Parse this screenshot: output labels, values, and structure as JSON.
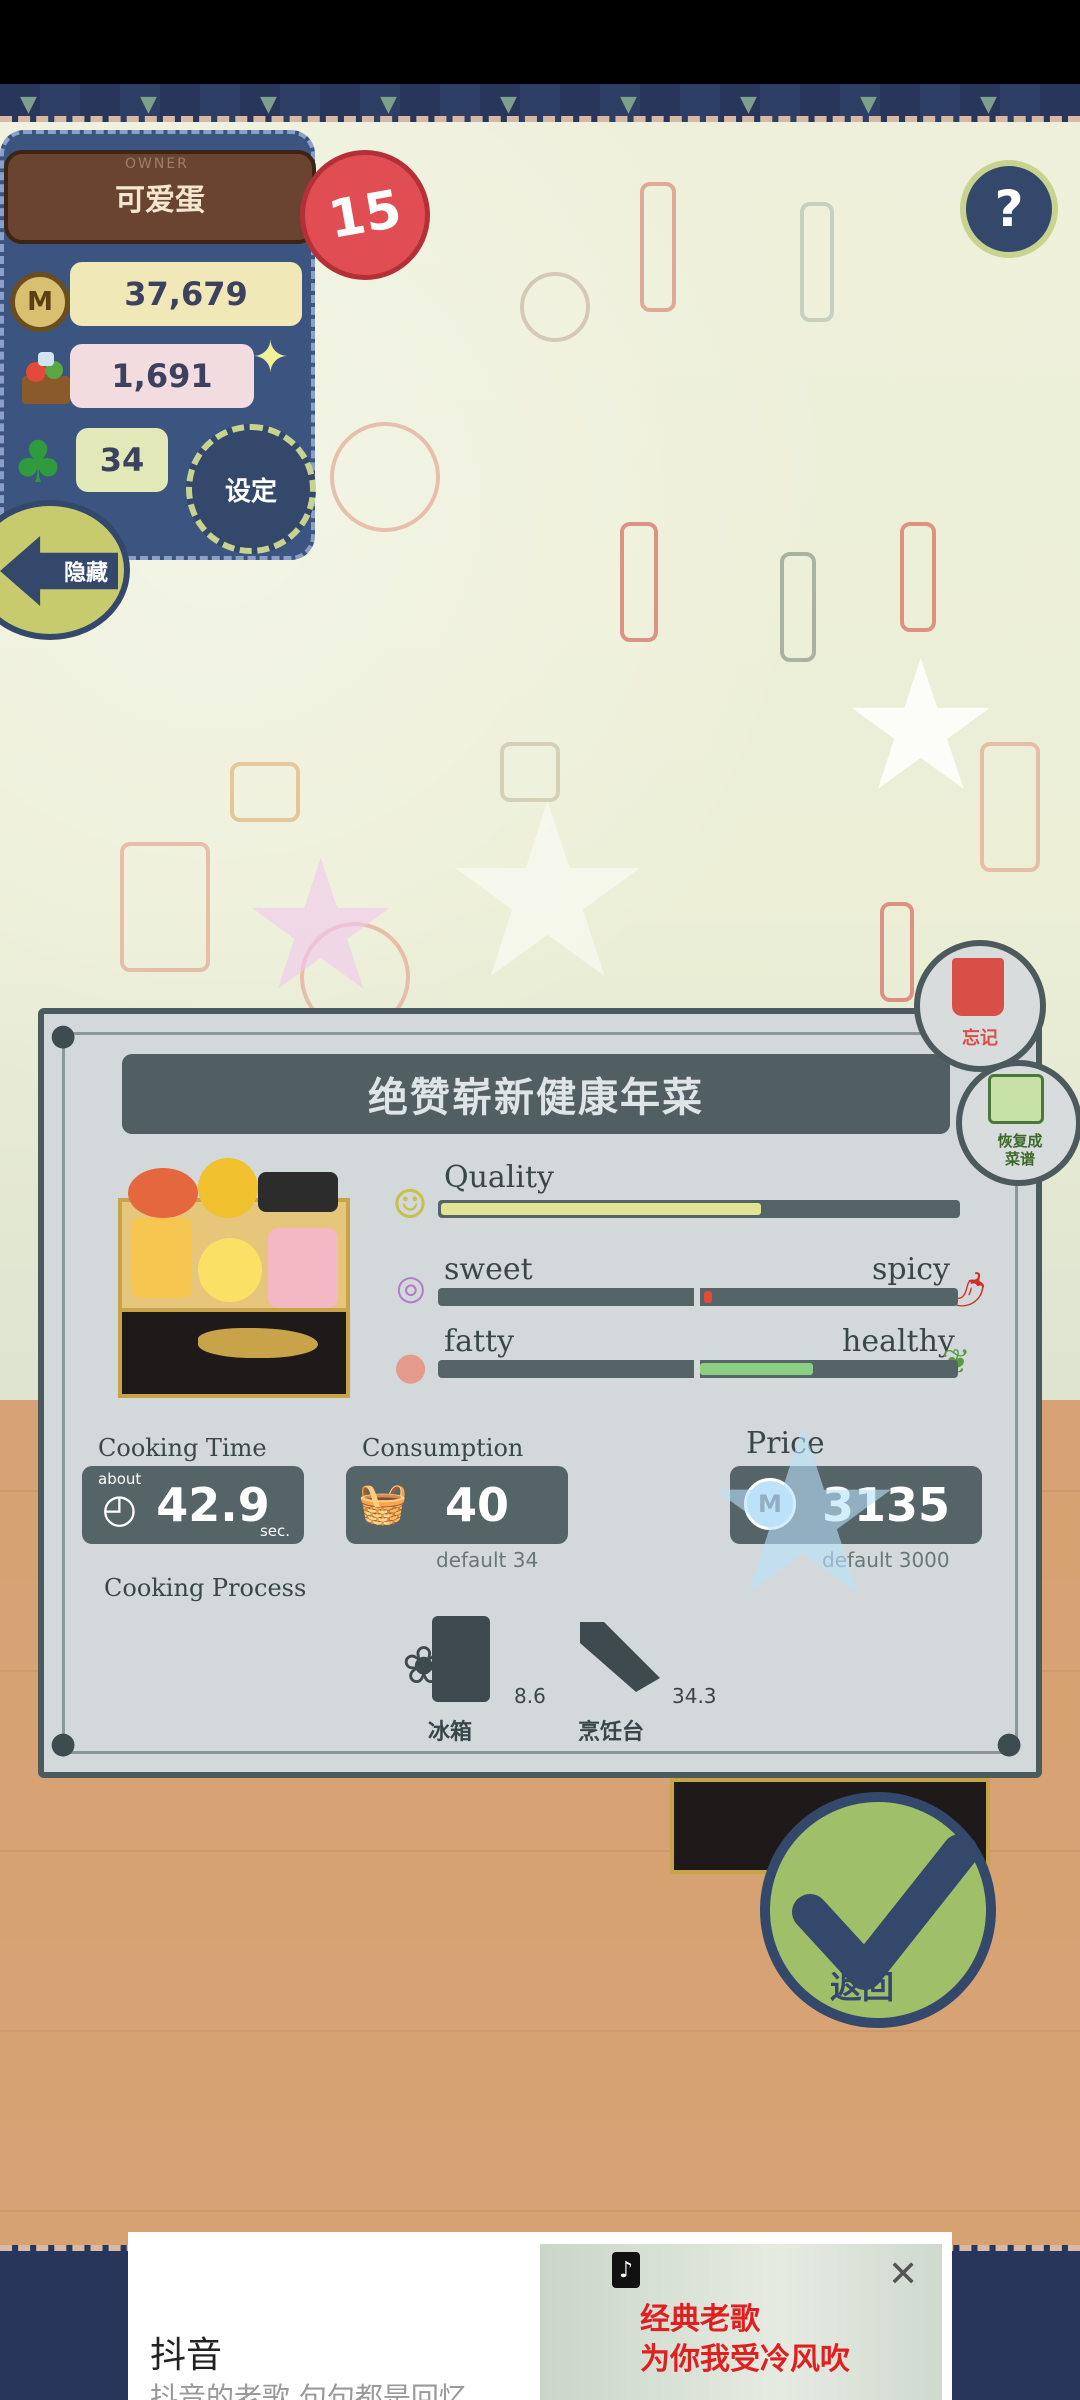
{
  "hud": {
    "owner_tag": "OWNER",
    "owner_name": "可爱蛋",
    "level": "15",
    "coins": "37,679",
    "ingredients": "1,691",
    "clovers": "34",
    "settings_label": "设定",
    "hide_label": "隐藏",
    "help_label": "?"
  },
  "recipe": {
    "title": "绝赞崭新健康年菜",
    "forget_label": "忘记",
    "restore_label": "恢复成\n菜谱",
    "meters": {
      "quality_label": "Quality",
      "quality_value": 0.62,
      "sweet_label": "sweet",
      "spicy_label": "spicy",
      "taste_value": 0.52,
      "fatty_label": "fatty",
      "healthy_label": "healthy",
      "health_value": 0.72
    },
    "cooking_time_label": "Cooking Time",
    "cooking_time_about": "about",
    "cooking_time_value": "42.9",
    "cooking_time_unit": "sec.",
    "consumption_label": "Consumption",
    "consumption_value": "40",
    "consumption_default": "default 34",
    "price_label": "Price",
    "price_value": "3135",
    "price_default": "default 3000",
    "process_label": "Cooking Process",
    "process": [
      {
        "name": "冰箱",
        "value": "8.6"
      },
      {
        "name": "烹饪台",
        "value": "34.3"
      }
    ],
    "confirm_label": "返回"
  },
  "ad": {
    "title": "抖音",
    "subtitle": "抖音的老歌 句句都是回忆",
    "image_caption": "经典老歌\n为你我受冷风吹",
    "close": "✕",
    "logo": "♪"
  }
}
